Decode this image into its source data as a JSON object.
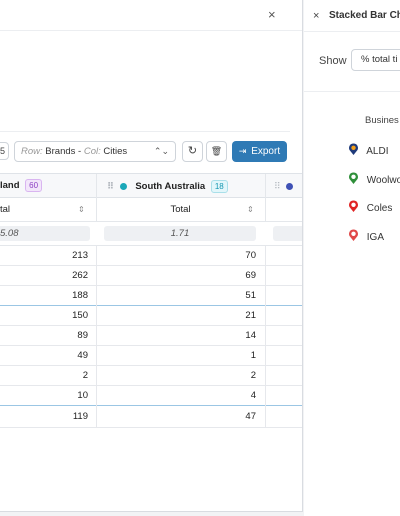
{
  "left_panel": {
    "close_glyph": "×",
    "toolbar": {
      "small_value": "5",
      "row_label": "Row:",
      "row_value": "Brands",
      "separator": "-",
      "col_label": "Col:",
      "col_value": "Cities",
      "chevron": "⌃⌄",
      "refresh_icon": "↻",
      "delete_icon": "🗑",
      "export_icon": "⇥",
      "export_label": "Export"
    },
    "columns": [
      {
        "name": "land",
        "badge": "60",
        "sub_label": "tal",
        "total": "5.08"
      },
      {
        "name": "South Australia",
        "badge": "18",
        "sub_label": "Total",
        "total": "1.71",
        "dot_color": "#1aa7b8"
      },
      {
        "dot_color": "#3f51b5"
      }
    ],
    "rows": [
      {
        "v1": "213",
        "v2": "70"
      },
      {
        "v1": "262",
        "v2": "69"
      },
      {
        "v1": "188",
        "v2": "51"
      },
      {
        "v1": "150",
        "v2": "21"
      },
      {
        "v1": "89",
        "v2": "14"
      },
      {
        "v1": "49",
        "v2": "1"
      },
      {
        "v1": "2",
        "v2": "2"
      },
      {
        "v1": "10",
        "v2": "4"
      },
      {
        "v1": "119",
        "v2": "47"
      }
    ],
    "sort_glyph": "⇕"
  },
  "right_panel": {
    "close_glyph": "×",
    "title": "Stacked Bar Ch",
    "show_label": "Show",
    "select_value": "% total ti",
    "legend_title": "Busines",
    "legend": [
      {
        "label": "ALDI",
        "icon": "aldi-logo-icon",
        "color": "#1f3a7a"
      },
      {
        "label": "Woolwo",
        "icon": "woolworths-logo-icon",
        "color": "#2f8f3a"
      },
      {
        "label": "Coles",
        "icon": "coles-logo-icon",
        "color": "#e02424"
      },
      {
        "label": "IGA",
        "icon": "iga-logo-icon",
        "color": "#e04848"
      }
    ]
  },
  "colors": {
    "accent": "#2f7ab5",
    "highlight_border": "#9bc6e4"
  }
}
